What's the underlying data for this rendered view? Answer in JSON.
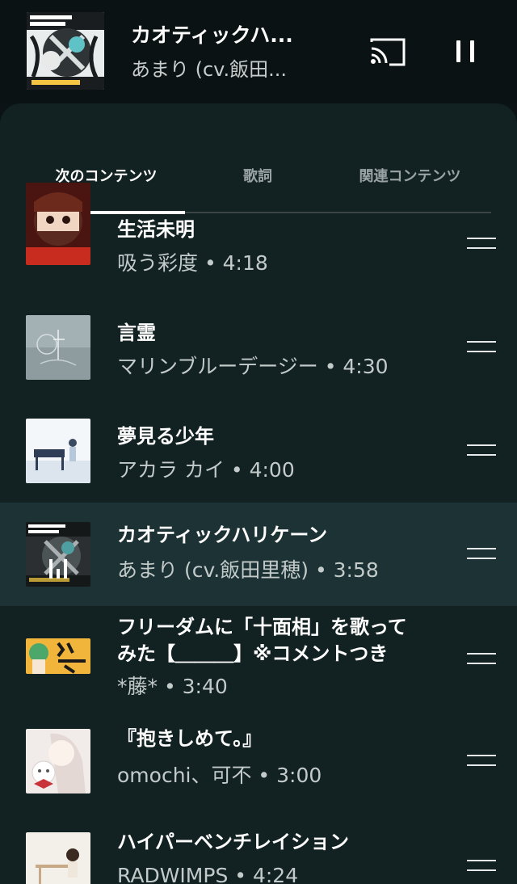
{
  "mini_player": {
    "title": "カオティックハ...",
    "artist": "あまり (cv.飯田...",
    "art_icon": "album-art-chaotic-hurricane"
  },
  "tabs": [
    {
      "label": "次のコンテンツ",
      "active": true
    },
    {
      "label": "歌詞",
      "active": false
    },
    {
      "label": "関連コンテンツ",
      "active": false
    }
  ],
  "queue": [
    {
      "title": "生活未明",
      "subtitle": "吸う彩度 • 4:18",
      "playing": false,
      "art_color": "#6a1f18"
    },
    {
      "title": "言霊",
      "subtitle": "マリンブルーデージー • 4:30",
      "playing": false,
      "art_color": "#8b9a9e"
    },
    {
      "title": "夢見る少年",
      "subtitle": "アカラ カイ • 4:00",
      "playing": false,
      "art_color": "#dfe7ee"
    },
    {
      "title": "カオティックハリケーン",
      "subtitle": "あまり (cv.飯田里穂) • 3:58",
      "playing": true,
      "art_color": "#2b2f31"
    },
    {
      "title": "フリーダムに「十面相」を歌ってみた【＿＿＿】※コメントつき",
      "subtitle": "*藤* • 3:40",
      "playing": false,
      "art_color": "#e8b13a"
    },
    {
      "title": "『抱きしめて。』",
      "subtitle": "omochi、可不 • 3:00",
      "playing": false,
      "art_color": "#efe9e6"
    },
    {
      "title": "ハイパーベンチレイション",
      "subtitle": "RADWIMPS • 4:24",
      "playing": false,
      "art_color": "#f2eee8"
    }
  ],
  "colors": {
    "background": "#0c1314",
    "sheet": "#122122",
    "playing_row": "#1c3234",
    "secondary_text": "#c3caca"
  }
}
